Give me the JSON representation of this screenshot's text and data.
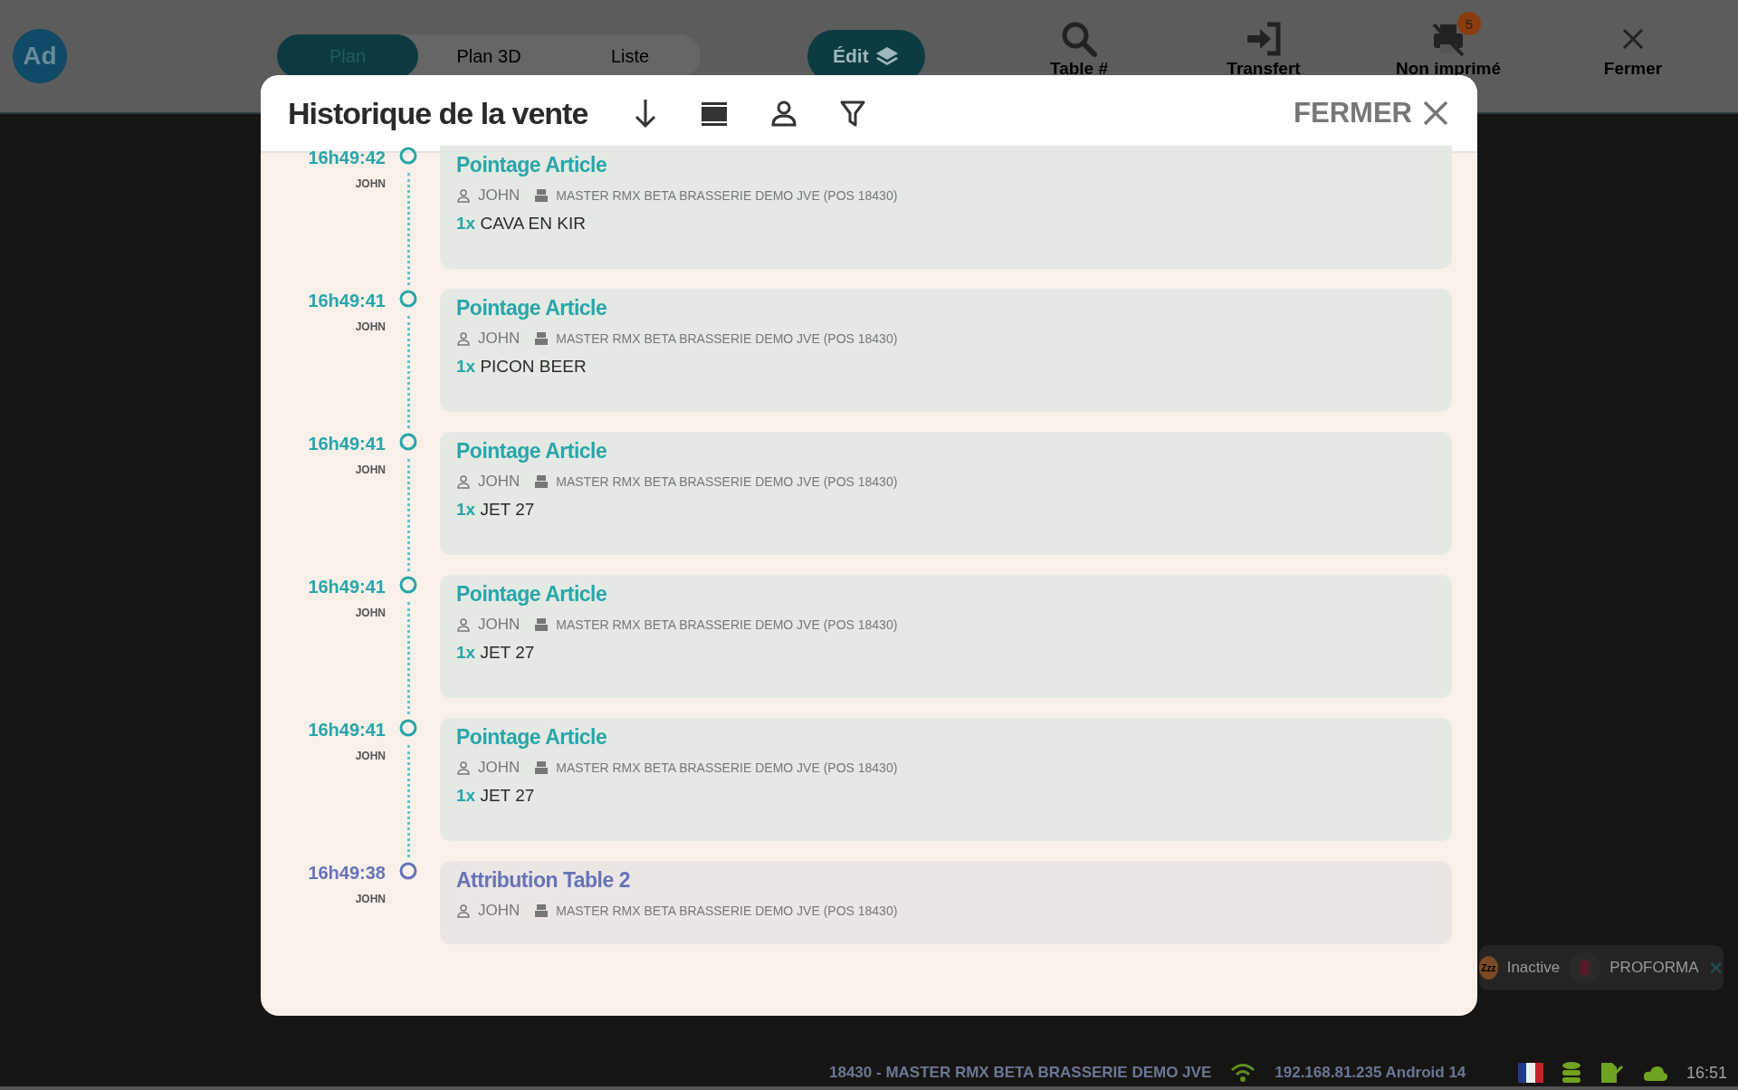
{
  "topbar": {
    "avatar": "Ad",
    "view_tabs": [
      {
        "label": "Plan",
        "selected": true
      },
      {
        "label": "Plan 3D",
        "selected": false
      },
      {
        "label": "Liste",
        "selected": false
      }
    ],
    "edit_button": "Édit",
    "actions": [
      {
        "kind": "search",
        "label": "Table #"
      },
      {
        "kind": "transfer",
        "label": "Transfert"
      },
      {
        "kind": "unprinted",
        "label": "Non imprimé",
        "badge": "5"
      },
      {
        "kind": "close",
        "label": "Fermer"
      }
    ]
  },
  "modal": {
    "title": "Historique de la vente",
    "close_label": "FERMER",
    "entries": [
      {
        "kind": "article",
        "time": "16h49:42",
        "user": "JOHN",
        "title": "Pointage Article",
        "operator": "JOHN",
        "device": "MASTER RMX BETA BRASSERIE DEMO JVE (POS 18430)",
        "qty": "1x",
        "item": "CAVA EN KIR"
      },
      {
        "kind": "article",
        "time": "16h49:41",
        "user": "JOHN",
        "title": "Pointage Article",
        "operator": "JOHN",
        "device": "MASTER RMX BETA BRASSERIE DEMO JVE (POS 18430)",
        "qty": "1x",
        "item": "PICON BEER"
      },
      {
        "kind": "article",
        "time": "16h49:41",
        "user": "JOHN",
        "title": "Pointage Article",
        "operator": "JOHN",
        "device": "MASTER RMX BETA BRASSERIE DEMO JVE (POS 18430)",
        "qty": "1x",
        "item": "JET 27"
      },
      {
        "kind": "article",
        "time": "16h49:41",
        "user": "JOHN",
        "title": "Pointage Article",
        "operator": "JOHN",
        "device": "MASTER RMX BETA BRASSERIE DEMO JVE (POS 18430)",
        "qty": "1x",
        "item": "JET 27"
      },
      {
        "kind": "article",
        "time": "16h49:41",
        "user": "JOHN",
        "title": "Pointage Article",
        "operator": "JOHN",
        "device": "MASTER RMX BETA BRASSERIE DEMO JVE (POS 18430)",
        "qty": "1x",
        "item": "JET 27"
      },
      {
        "kind": "attribution",
        "time": "16h49:38",
        "user": "JOHN",
        "title": "Attribution Table 2",
        "operator": "JOHN",
        "device": "MASTER RMX BETA BRASSERIE DEMO JVE (POS 18430)"
      }
    ]
  },
  "status_chip": {
    "badge": "Zzz",
    "state": "Inactive",
    "mode": "PROFORMA"
  },
  "status_bar": {
    "site": "18430 - MASTER RMX BETA BRASSERIE DEMO JVE",
    "network": "192.168.81.235 Android 14",
    "time": "16:51"
  }
}
